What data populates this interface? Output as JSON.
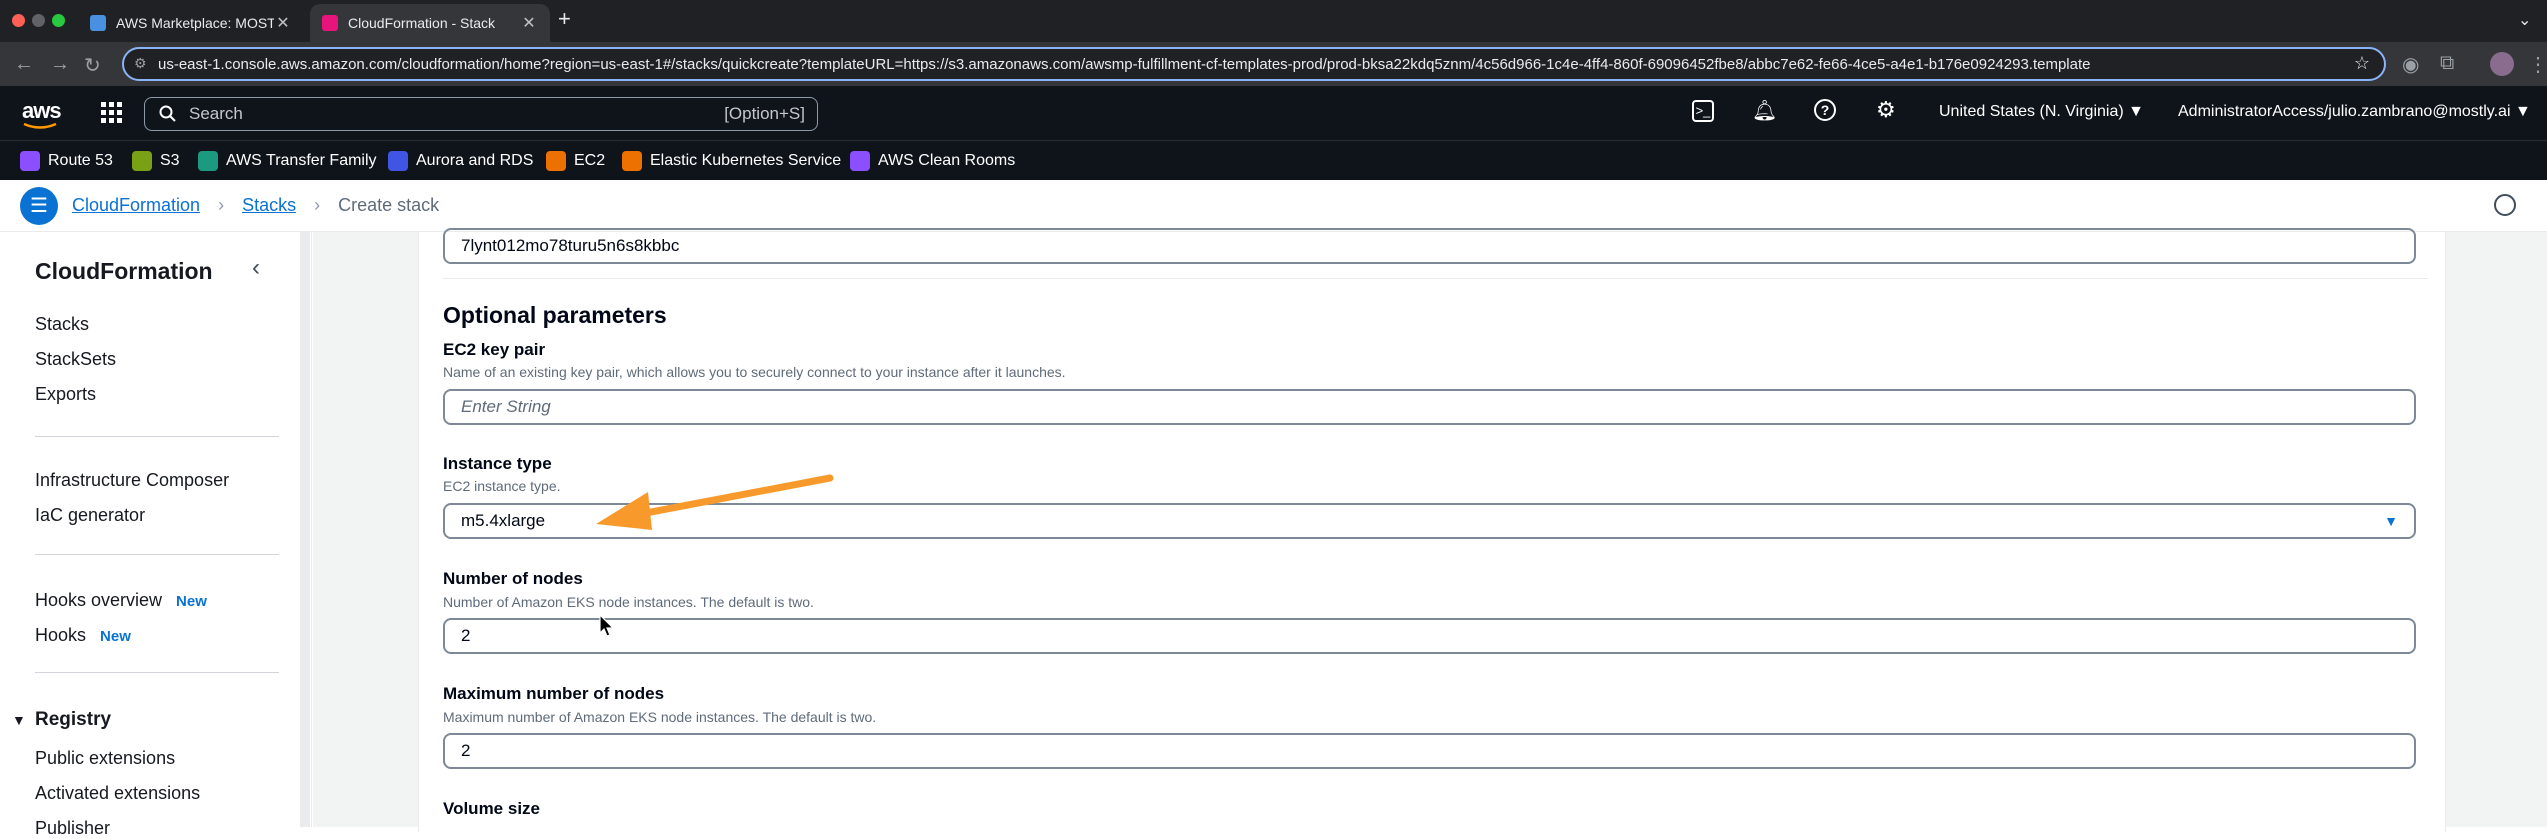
{
  "browser": {
    "tabs": [
      {
        "title": "AWS Marketplace: MOSTLY A",
        "active": false
      },
      {
        "title": "CloudFormation - Stack",
        "active": true
      }
    ],
    "url": "us-east-1.console.aws.amazon.com/cloudformation/home?region=us-east-1#/stacks/quickcreate?templateURL=https://s3.amazonaws.com/awsmp-fulfillment-cf-templates-prod/prod-bksa22kdq5znm/4c56d966-1c4e-4ff4-860f-69096452fbe8/abbc7e62-fe66-4ce5-a4e1-b176e0924293.template"
  },
  "aws_header": {
    "logo": "aws",
    "search_placeholder": "Search",
    "search_shortcut": "[Option+S]",
    "region": "United States (N. Virginia)",
    "account": "AdministratorAccess/julio.zambrano@mostly.ai"
  },
  "favorites": [
    {
      "label": "Route 53",
      "color": "#8c4fff"
    },
    {
      "label": "S3",
      "color": "#7aa116"
    },
    {
      "label": "AWS Transfer Family",
      "color": "#1b9a7f"
    },
    {
      "label": "Aurora and RDS",
      "color": "#4055e3"
    },
    {
      "label": "EC2",
      "color": "#ed7100"
    },
    {
      "label": "Elastic Kubernetes Service",
      "color": "#ed7100"
    },
    {
      "label": "AWS Clean Rooms",
      "color": "#8c4fff"
    }
  ],
  "breadcrumb": {
    "items": [
      "CloudFormation",
      "Stacks"
    ],
    "current": "Create stack"
  },
  "sidebar": {
    "title": "CloudFormation",
    "group1": [
      "Stacks",
      "StackSets",
      "Exports"
    ],
    "group2": [
      "Infrastructure Composer",
      "IaC generator"
    ],
    "group3": [
      {
        "label": "Hooks overview",
        "badge": "New"
      },
      {
        "label": "Hooks",
        "badge": "New"
      }
    ],
    "registry": {
      "title": "Registry",
      "items": [
        "Public extensions",
        "Activated extensions",
        "Publisher"
      ]
    }
  },
  "form": {
    "top_value": "7lynt012mo78turu5n6s8kbbc",
    "section_title": "Optional parameters",
    "params": [
      {
        "label": "EC2 key pair",
        "description": "Name of an existing key pair, which allows you to securely connect to your instance after it launches.",
        "placeholder": "Enter String",
        "value": ""
      },
      {
        "label": "Instance type",
        "description": "EC2 instance type.",
        "value": "m5.4xlarge"
      },
      {
        "label": "Number of nodes",
        "description": "Number of Amazon EKS node instances. The default is two.",
        "value": "2"
      },
      {
        "label": "Maximum number of nodes",
        "description": "Maximum number of Amazon EKS node instances. The default is two.",
        "value": "2"
      },
      {
        "label": "Volume size",
        "description": ""
      }
    ]
  },
  "colors": {
    "accent": "#0972d3",
    "annotation_arrow": "#f89a2b",
    "aws_nav": "#0f141a"
  }
}
